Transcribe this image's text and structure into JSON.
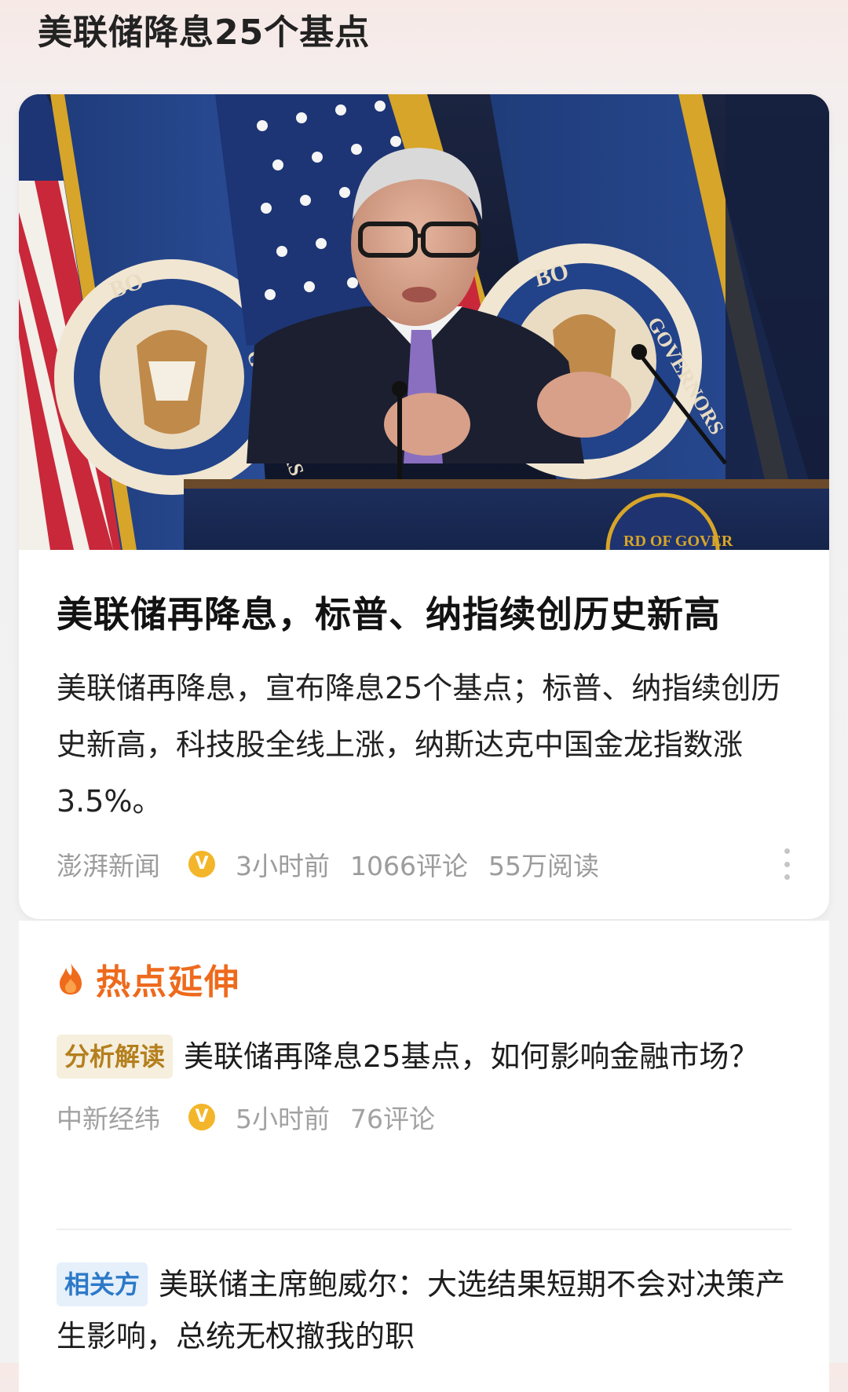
{
  "page": {
    "title": "美联储降息25个基点"
  },
  "main_card": {
    "image_alt": "美联储主席在发布会讲台前讲话，背景为美国国旗与联储理事会旗帜",
    "headline": "美联储再降息，标普、纳指续创历史新高",
    "summary": "美联储再降息，宣布降息25个基点；标普、纳指续创历史新高，科技股全线上涨，纳斯达克中国金龙指数涨3.5%。",
    "source": "澎湃新闻",
    "verified_badge": "V",
    "time": "3小时前",
    "comments": "1066评论",
    "reads": "55万阅读"
  },
  "hot_extension": {
    "label": "热点延伸",
    "items": [
      {
        "tag": "分析解读",
        "title": "美联储再降息25基点，如何影响金融市场？",
        "source": "中新经纬",
        "verified_badge": "V",
        "time": "5小时前",
        "comments": "76评论"
      },
      {
        "tag": "相关方",
        "title": "美联储主席鲍威尔：大选结果短期不会对决策产生影响，总统无权撤我的职"
      }
    ]
  },
  "colors": {
    "hot_orange": "#ee6a1c",
    "tag_analysis_bg": "#f6efde",
    "tag_analysis_text": "#b47f1d",
    "tag_related_bg": "#e5f0fb",
    "tag_related_text": "#2d79c7",
    "verified_gold": "#f3b52a",
    "meta_gray": "#9c9c9c"
  }
}
